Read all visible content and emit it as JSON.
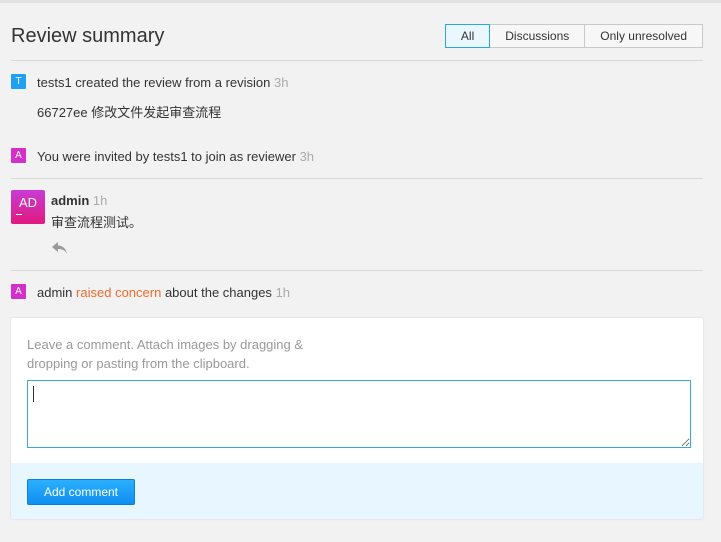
{
  "header": {
    "title": "Review summary",
    "filters": [
      "All",
      "Discussions",
      "Only unresolved"
    ],
    "active_filter": "All"
  },
  "events": [
    {
      "badge": "T",
      "text": "tests1 created the review from a revision",
      "time": "3h"
    },
    {
      "badge": "A",
      "text": "You were invited by tests1 to join as reviewer",
      "time": "3h"
    }
  ],
  "commit": {
    "hash": "66727ee",
    "message": "修改文件发起审查流程"
  },
  "comment": {
    "avatar_initials": "AD",
    "author": "admin",
    "time": "1h",
    "body": "审查流程测试。"
  },
  "concern_event": {
    "badge": "A",
    "actor": "admin",
    "action": "raised concern",
    "suffix": "about the changes",
    "time": "1h"
  },
  "composer": {
    "hint": "Leave a comment. Attach images by dragging & dropping or pasting from the clipboard.",
    "value": "",
    "submit_label": "Add comment"
  },
  "colors": {
    "accent": "#1ea1f2",
    "badge_t": "#1ea1f2",
    "badge_a": "#d42fcb",
    "concern": "#f06a2d",
    "time": "#aaaaaa"
  },
  "icons": [
    "reply-icon"
  ]
}
